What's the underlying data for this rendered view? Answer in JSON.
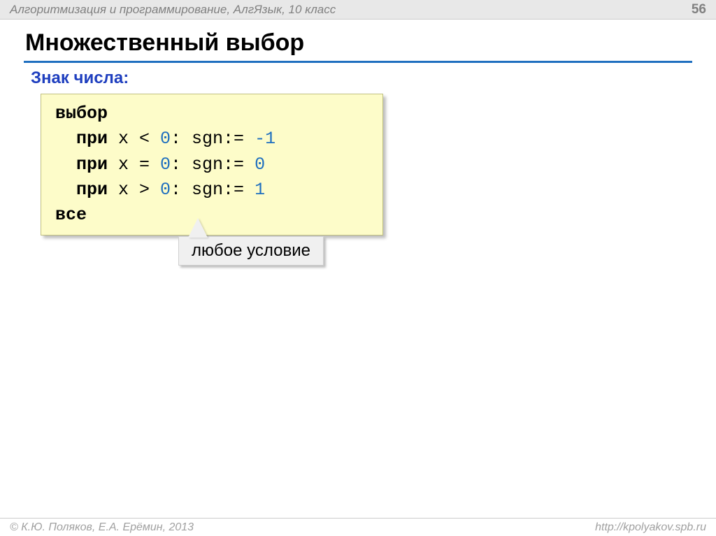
{
  "header": {
    "title": "Алгоритмизация и программирование, АлгЯзык, 10 класс",
    "page": "56"
  },
  "title": "Множественный выбор",
  "subtitle": "Знак числа:",
  "code": {
    "kw_select": "выбор",
    "kw_case1": "  при",
    "c1_expr": " x < ",
    "c1_zero": "0",
    "c1_mid": ": sgn:= ",
    "c1_val": "-1",
    "kw_case2": "  при",
    "c2_expr": " x = ",
    "c2_zero": "0",
    "c2_mid": ": sgn:= ",
    "c2_val": "0",
    "kw_case3": "  при",
    "c3_expr": " x > ",
    "c3_zero": "0",
    "c3_mid": ": sgn:= ",
    "c3_val": "1",
    "kw_end": "все"
  },
  "callout": "любое условие",
  "footer": {
    "copyright": "© К.Ю. Поляков, Е.А. Ерёмин, 2013",
    "url": "http://kpolyakov.spb.ru"
  }
}
